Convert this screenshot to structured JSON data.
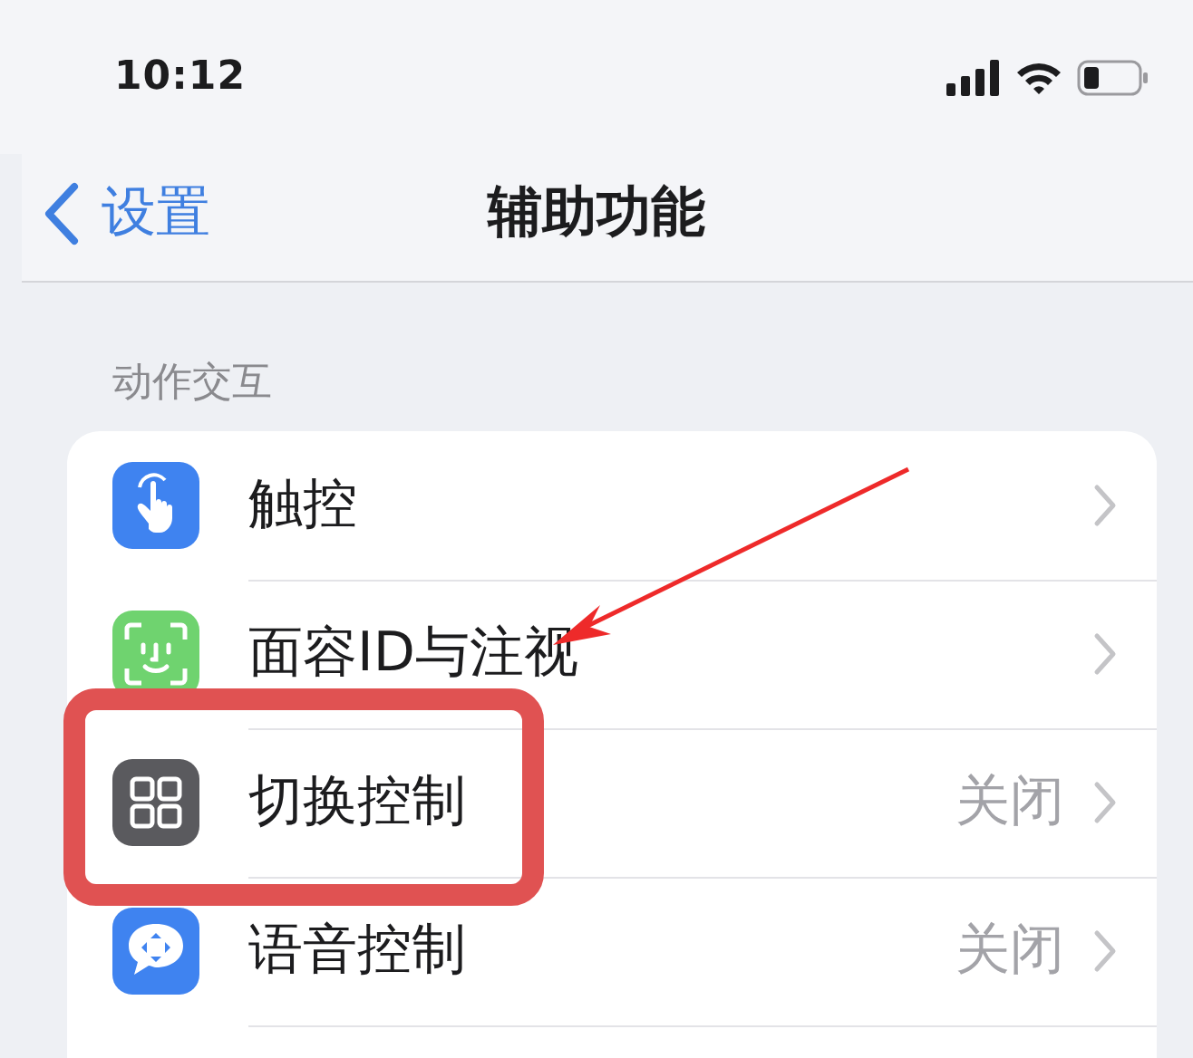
{
  "status_bar": {
    "time": "10:12"
  },
  "nav_bar": {
    "back": "设置",
    "title": "辅助功能"
  },
  "section": {
    "header": "动作交互",
    "rows": [
      {
        "kind": "hand",
        "label": "触控",
        "highlighted": false,
        "arrow_pointing": false
      },
      {
        "kind": "face",
        "label": "面容ID与注视",
        "highlighted": false,
        "arrow_pointing": true
      },
      {
        "kind": "grid",
        "label": "切换控制",
        "value": "关闭",
        "highlighted": true,
        "arrow_pointing": false
      },
      {
        "kind": "speech",
        "label": "语音控制",
        "value": "关闭",
        "highlighted": false,
        "arrow_pointing": false
      }
    ]
  }
}
